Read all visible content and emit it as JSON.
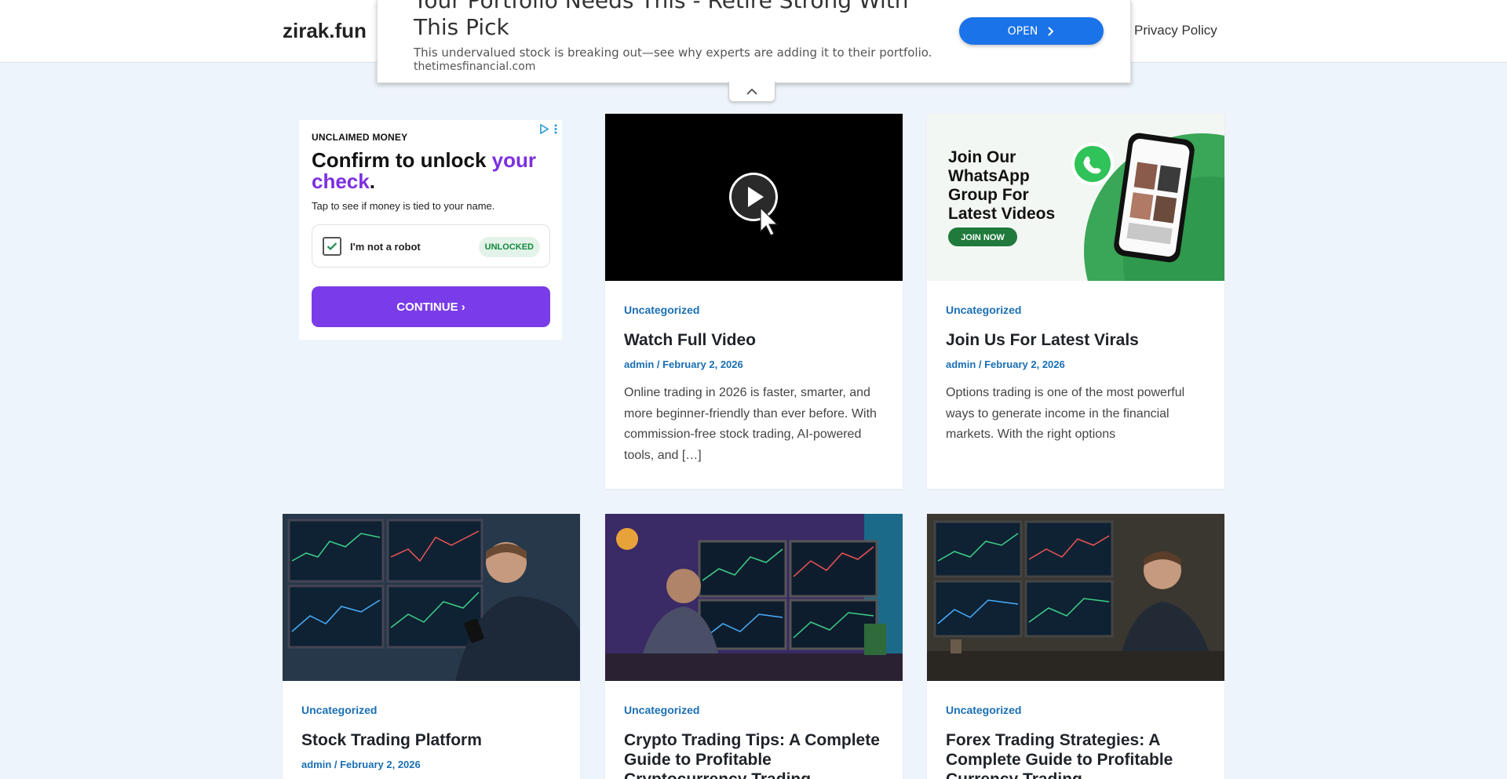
{
  "header": {
    "site_title": "zirak.fun",
    "nav_privacy": "Privacy Policy"
  },
  "top_ad": {
    "headline": "Your Portfolio Needs This - Retire Strong With This Pick",
    "description": "This undervalued stock is breaking out—see why experts are adding it to their portfolio.",
    "domain": "thetimesfinancial.com",
    "open_label": "OPEN"
  },
  "side_ad": {
    "label": "UNCLAIMED MONEY",
    "title_part1": "Confirm to unlock ",
    "title_highlight": "your check",
    "title_end": ".",
    "subtitle": "Tap to see if money is tied to your name.",
    "robot_text": "I'm not a robot",
    "badge": "UNLOCKED",
    "continue_label": "CONTINUE ›"
  },
  "whatsapp_promo": {
    "line1": "Join Our",
    "line2": "WhatsApp",
    "line3": "Group For",
    "line4": "Latest Videos",
    "button": "JOIN NOW"
  },
  "posts": [
    {
      "category": "Uncategorized",
      "title": "Watch Full Video",
      "meta": "admin / February 2, 2026",
      "excerpt": "Online trading in 2026 is faster, smarter, and more beginner-friendly than ever before. With commission-free stock trading, AI-powered tools, and […]"
    },
    {
      "category": "Uncategorized",
      "title": "Join Us For Latest Virals",
      "meta": "admin / February 2, 2026",
      "excerpt": "Options trading is one of the most powerful ways to generate income in the financial markets. With the right options"
    },
    {
      "category": "Uncategorized",
      "title": "Stock Trading Platform",
      "meta": "admin / February 2, 2026",
      "excerpt": ""
    },
    {
      "category": "Uncategorized",
      "title": "Crypto Trading Tips: A Complete Guide to Profitable Cryptocurrency Trading",
      "meta": "",
      "excerpt": ""
    },
    {
      "category": "Uncategorized",
      "title": "Forex Trading Strategies: A Complete Guide to Profitable Currency Trading",
      "meta": "",
      "excerpt": ""
    }
  ],
  "colors": {
    "link_blue": "#1a6fb4",
    "ad_purple": "#7a3ce8",
    "open_blue": "#1a73e8",
    "page_bg": "#eef4fb"
  }
}
